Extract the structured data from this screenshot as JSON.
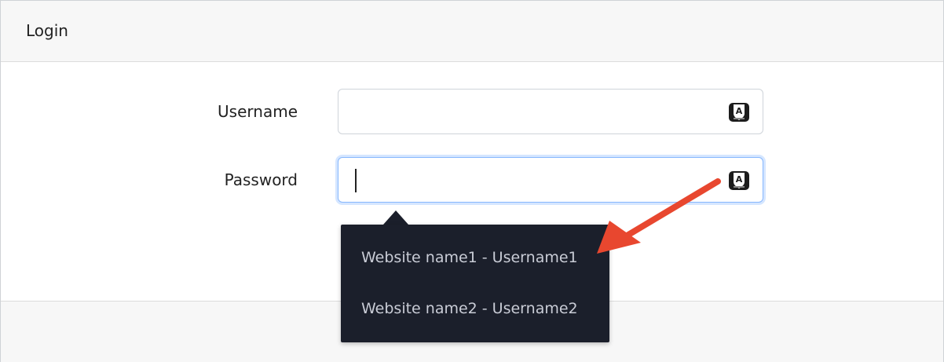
{
  "header": {
    "title": "Login"
  },
  "form": {
    "username_label": "Username",
    "username_value": "",
    "password_label": "Password",
    "password_value": ""
  },
  "extension": {
    "icon": "autofill-extension-icon",
    "badge_letter": "A"
  },
  "dropdown": {
    "items": [
      {
        "label": "Website name1 - Username1"
      },
      {
        "label": "Website name2 - Username2"
      }
    ]
  },
  "colors": {
    "dropdown_bg": "#1b1f2b",
    "focus_ring": "#86b7fe",
    "annotation_arrow": "#e8472f"
  }
}
